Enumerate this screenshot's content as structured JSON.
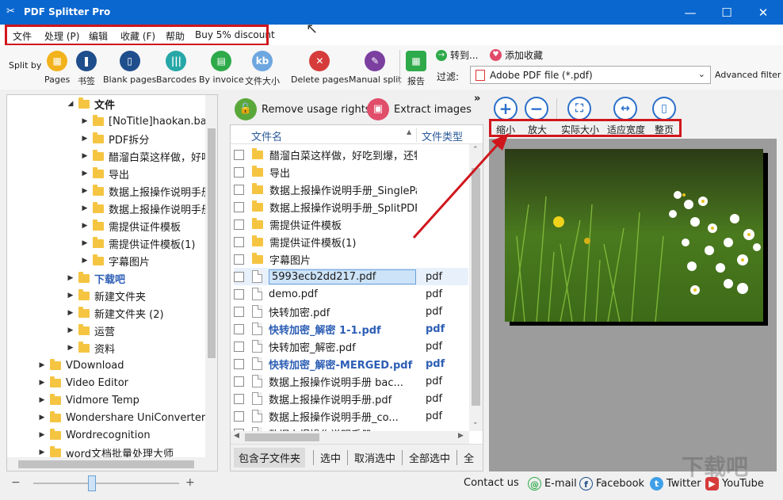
{
  "window": {
    "title": "PDF Splitter Pro",
    "minimize": "—",
    "maximize": "☐",
    "close": "✕"
  },
  "menu": {
    "items": [
      "文件",
      "处理 (P)",
      "编辑",
      "收藏 (F)",
      "帮助",
      "Buy 5% discount"
    ]
  },
  "toolbar": {
    "split_by": "Split by",
    "buttons": [
      "Pages",
      "书签",
      "Blank pages",
      "Barcodes",
      "By invoice",
      "文件大小",
      "Delete pages",
      "Manual split",
      "报告"
    ],
    "goto": "转到...",
    "add_favorite": "添加收藏",
    "filter_label": "过滤:",
    "filter_value": "Adobe PDF file (*.pdf)",
    "advanced_filter": "Advanced filter"
  },
  "tree": {
    "root": "文件",
    "items": [
      "[NoTitle]haokan.baidu",
      "PDF拆分",
      "醋溜白菜这样做，好吃",
      "导出",
      "数据上报操作说明手册",
      "数据上报操作说明手册",
      "需提供证件模板",
      "需提供证件模板(1)",
      "字幕图片",
      "下载吧",
      "新建文件夹",
      "新建文件夹 (2)",
      "运营",
      "资料",
      "VDownload",
      "Video Editor",
      "Vidmore Temp",
      "Wondershare UniConverter",
      "Wordrecognition",
      "word文档批量处理大师"
    ]
  },
  "filepanel": {
    "remove_usage": "Remove usage rights",
    "extract_images": "Extract images",
    "more": "»",
    "col_name": "文件名",
    "col_type": "文件类型",
    "sort_arrow": "▲",
    "rows": [
      {
        "name": "醋溜白菜这样做，好吃到爆，还特别下饭",
        "type": ""
      },
      {
        "name": "导出",
        "type": ""
      },
      {
        "name": "数据上报操作说明手册_SinglePagePDF",
        "type": ""
      },
      {
        "name": "数据上报操作说明手册_SplitPDF",
        "type": ""
      },
      {
        "name": "需提供证件模板",
        "type": ""
      },
      {
        "name": "需提供证件模板(1)",
        "type": ""
      },
      {
        "name": "字幕图片",
        "type": ""
      },
      {
        "name": "5993ecb2dd217.pdf",
        "type": "pdf"
      },
      {
        "name": "demo.pdf",
        "type": "pdf"
      },
      {
        "name": "快转加密.pdf",
        "type": "pdf"
      },
      {
        "name": "快转加密_解密 1-1.pdf",
        "type": "pdf"
      },
      {
        "name": "快转加密_解密.pdf",
        "type": "pdf"
      },
      {
        "name": "快转加密_解密-MERGED.pdf",
        "type": "pdf"
      },
      {
        "name": "数据上报操作说明手册 bac...",
        "type": "pdf"
      },
      {
        "name": "数据上报操作说明手册.pdf",
        "type": "pdf"
      },
      {
        "name": "数据上报操作说明手册_co...",
        "type": "pdf"
      },
      {
        "name": "数据上报操作说明手册...",
        "type": ""
      }
    ],
    "bottom_buttons": [
      "包含子文件夹",
      "选中",
      "取消选中",
      "全部选中",
      "全"
    ]
  },
  "viewer": {
    "buttons": [
      "缩小",
      "放大",
      "实际大小",
      "适应宽度",
      "整页"
    ]
  },
  "footer": {
    "contact": "Contact us",
    "email": "E-mail",
    "facebook": "Facebook",
    "twitter": "Twitter",
    "youtube": "YouTube",
    "watermark": "下载吧",
    "zoom_minus": "−",
    "zoom_plus": "+",
    "zoom_level": 0.4
  },
  "colors": {
    "title_bar": "#0a67cf",
    "highlight_red": "#d0161d",
    "link_blue": "#2d5eb5"
  }
}
